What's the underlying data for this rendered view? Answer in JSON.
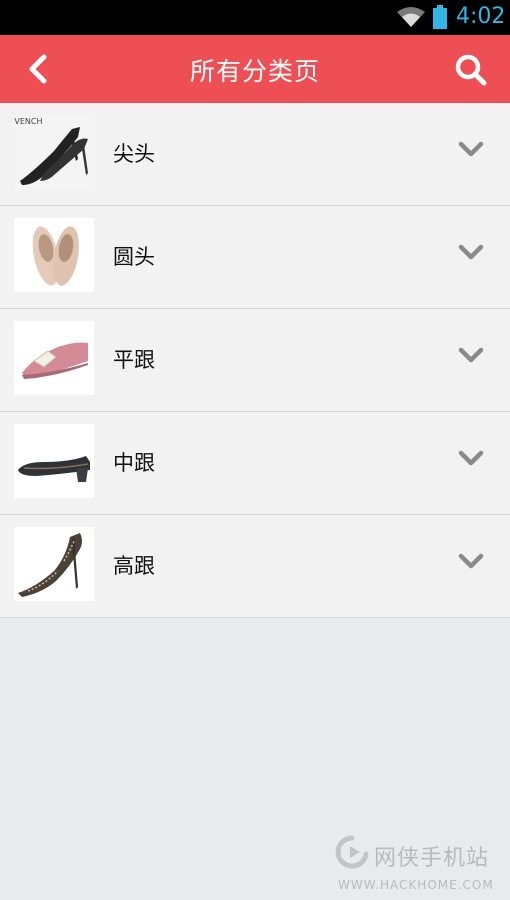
{
  "status_bar": {
    "time": "4:02",
    "icons": [
      "wifi-icon",
      "battery-icon"
    ]
  },
  "header": {
    "title": "所有分类页",
    "back_icon": "chevron-left-icon",
    "search_icon": "search-icon",
    "color": "#ee4f55"
  },
  "categories": [
    {
      "label": "尖头",
      "thumb_text": "IVENCH",
      "icon": "chevron-down-icon"
    },
    {
      "label": "圆头",
      "icon": "chevron-down-icon"
    },
    {
      "label": "平跟",
      "icon": "chevron-down-icon"
    },
    {
      "label": "中跟",
      "icon": "chevron-down-icon"
    },
    {
      "label": "高跟",
      "icon": "chevron-down-icon"
    }
  ],
  "watermark": {
    "name": "网侠手机站",
    "url": "WWW.HACKHOME.COM"
  }
}
